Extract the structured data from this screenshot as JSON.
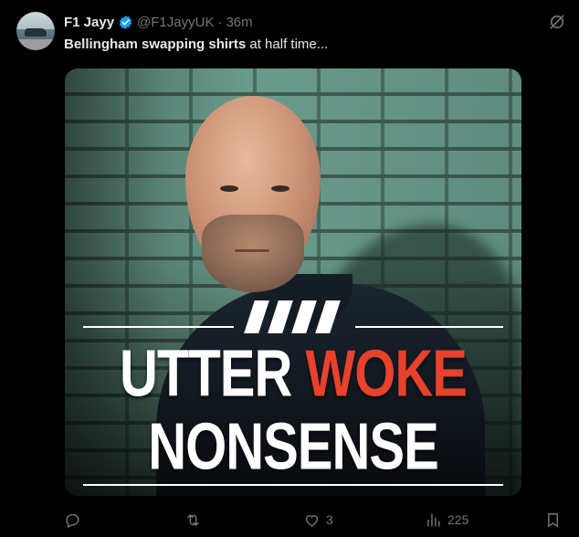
{
  "tweet": {
    "display_name": "F1 Jayy",
    "handle": "@F1JayyUK",
    "separator": "·",
    "time": "36m",
    "text_bold": "Bellingham swapping shirts",
    "text_rest": " at half time..."
  },
  "media": {
    "headline_word1": "UTTER",
    "headline_word2": "WOKE",
    "headline_line2": "NONSENSE",
    "accent_color": "#e8412c"
  },
  "actions": {
    "reply_count": "",
    "retweet_count": "",
    "like_count": "3",
    "views_count": "225"
  },
  "icons": {
    "verified": "verified-badge-icon",
    "grok": "grok-icon",
    "reply": "reply-icon",
    "retweet": "retweet-icon",
    "like": "heart-icon",
    "views": "views-icon",
    "bookmark": "bookmark-icon"
  },
  "colors": {
    "background": "#000000",
    "text": "#e7e9ea",
    "muted": "#71767b",
    "verified": "#1d9bf0"
  }
}
